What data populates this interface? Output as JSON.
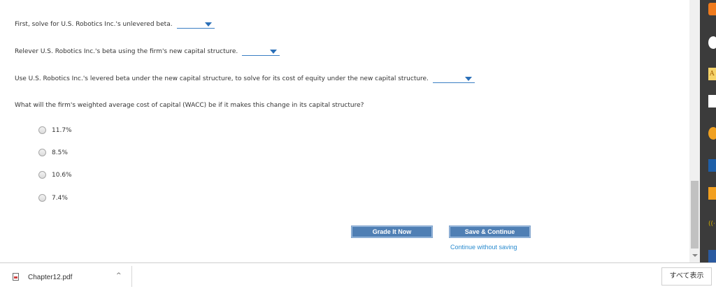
{
  "questions": [
    {
      "text": "First, solve for U.S. Robotics Inc.'s unlevered beta."
    },
    {
      "text": "Relever U.S. Robotics Inc.'s beta using the firm's new capital structure."
    },
    {
      "text": "Use U.S. Robotics Inc.'s levered beta under the new capital structure, to solve for its cost of equity under the new capital structure."
    },
    {
      "text": "What will the firm's weighted average cost of capital (WACC) be if it makes this change in its capital structure?"
    }
  ],
  "options": [
    "11.7%",
    "8.5%",
    "10.6%",
    "7.4%"
  ],
  "buttons": {
    "grade": "Grade It Now",
    "save": "Save & Continue",
    "continue_link": "Continue without saving"
  },
  "downloads": {
    "file_name": "Chapter12.pdf",
    "show_all": "すべて表示"
  },
  "colors": {
    "button_bg": "#4f7fb4",
    "link": "#2a8bcf",
    "dropdown_underline": "#3a7fc4"
  }
}
